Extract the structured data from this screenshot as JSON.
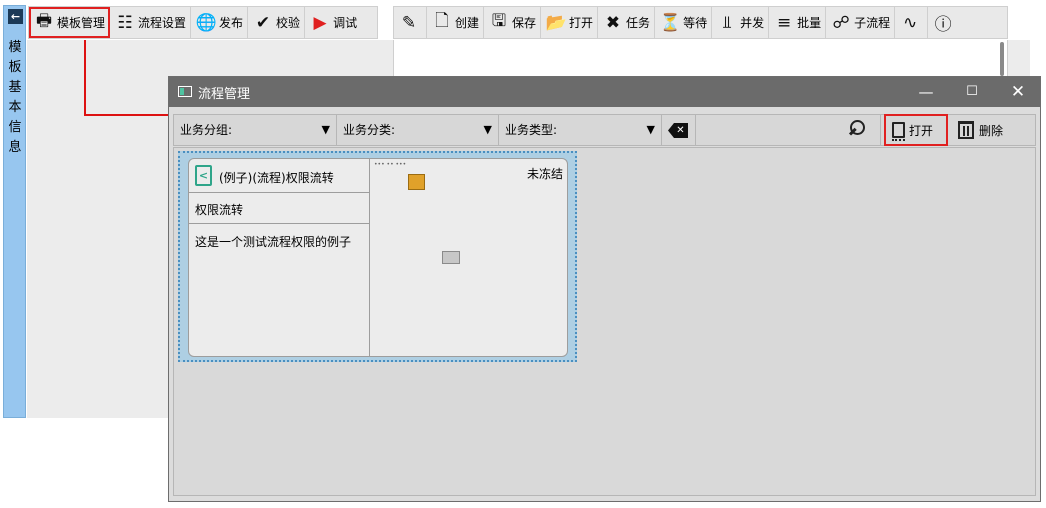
{
  "background": {
    "left_strip_chars": [
      "模",
      "板",
      "基",
      "本",
      "信",
      "息"
    ],
    "toolbar_left": [
      {
        "label": "模板管理",
        "icon": "printer-icon"
      },
      {
        "label": "流程设置",
        "icon": "org-chart-icon"
      },
      {
        "label": "发布",
        "icon": "globe-icon"
      },
      {
        "label": "校验",
        "icon": "check-icon"
      },
      {
        "label": "调试",
        "icon": "play-icon"
      }
    ],
    "toolbar_right": [
      {
        "label": "",
        "icon": "pencil-icon"
      },
      {
        "label": "创建",
        "icon": "new-doc-icon"
      },
      {
        "label": "保存",
        "icon": "save-icon"
      },
      {
        "label": "打开",
        "icon": "folder-open-icon"
      },
      {
        "label": "任务",
        "icon": "task-icon"
      },
      {
        "label": "等待",
        "icon": "wait-icon"
      },
      {
        "label": "并发",
        "icon": "fork-icon"
      },
      {
        "label": "批量",
        "icon": "batch-icon"
      },
      {
        "label": "子流程",
        "icon": "subflow-icon"
      },
      {
        "label": "",
        "icon": "connector-icon"
      },
      {
        "label": "",
        "icon": "info-icon"
      }
    ]
  },
  "dialog": {
    "title": "流程管理",
    "filters": {
      "group_label": "业务分组:",
      "class_label": "业务分类:",
      "type_label": "业务类型:"
    },
    "open_label": "打开",
    "delete_label": "删除",
    "card": {
      "name": "(例子)(流程)权限流转",
      "subtitle": "权限流转",
      "description": "这是一个测试流程权限的例子",
      "status": "未冻结"
    }
  },
  "colors": {
    "accent_red": "#e02020",
    "strip_blue": "#97c6ef",
    "titlebar_gray": "#6b6b6b",
    "card_selected_blue": "#aecfe3",
    "flow_icon_green": "#2fa58a",
    "node_orange": "#e0a12a"
  }
}
